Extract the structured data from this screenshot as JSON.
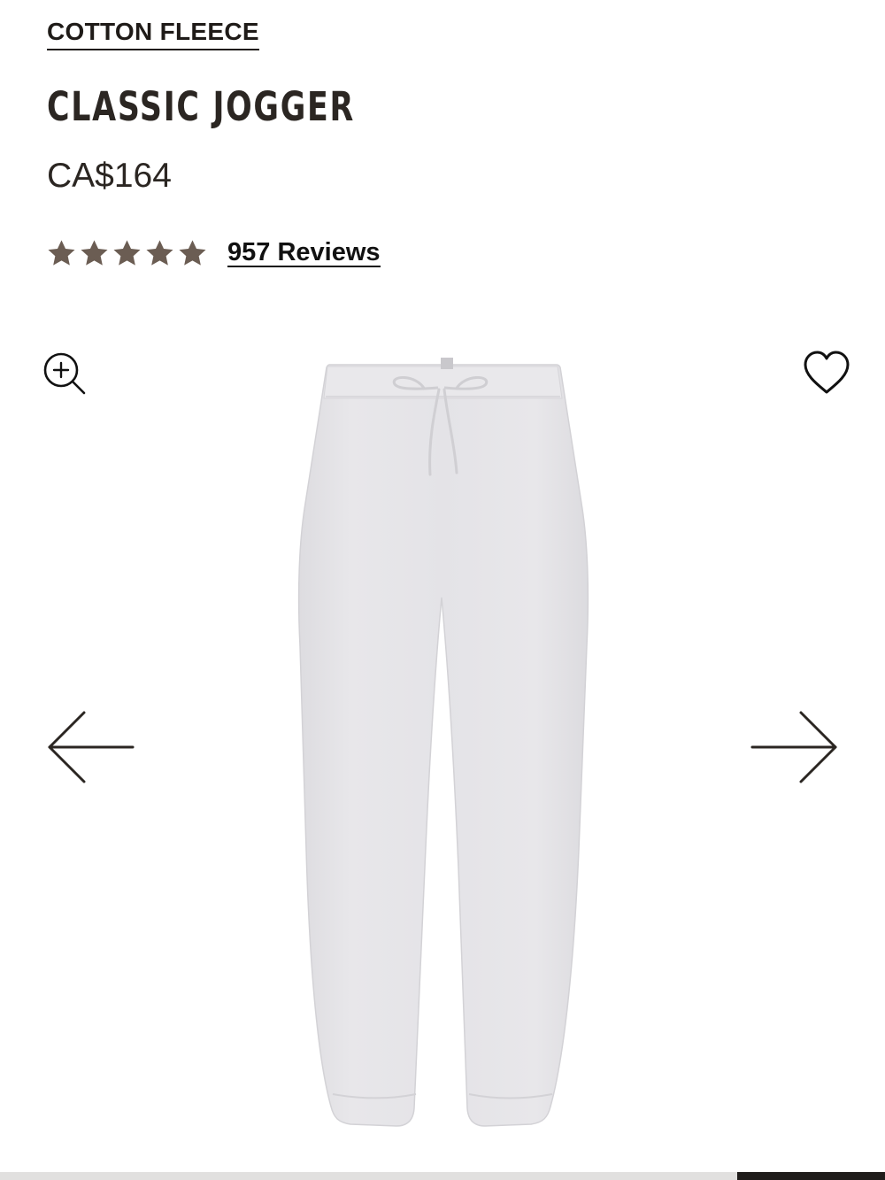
{
  "product": {
    "collection": "COTTON FLEECE",
    "title": "CLASSIC JOGGER",
    "price": "CA$164",
    "rating": 5,
    "reviews_label": "957 Reviews"
  },
  "gallery": {
    "image_alt": "Classic Jogger in light heather grey",
    "zoom_icon": "zoom-in-icon",
    "wishlist_icon": "heart-icon",
    "prev_icon": "arrow-left-icon",
    "next_icon": "arrow-right-icon",
    "progress": {
      "start": 0.833,
      "end": 1.0
    }
  },
  "colors": {
    "text": "#2b2622",
    "star": "#6b5d53",
    "product_fabric": "#e6e5e8",
    "progress_track": "#e1e0df",
    "progress_fill": "#201d1b"
  }
}
